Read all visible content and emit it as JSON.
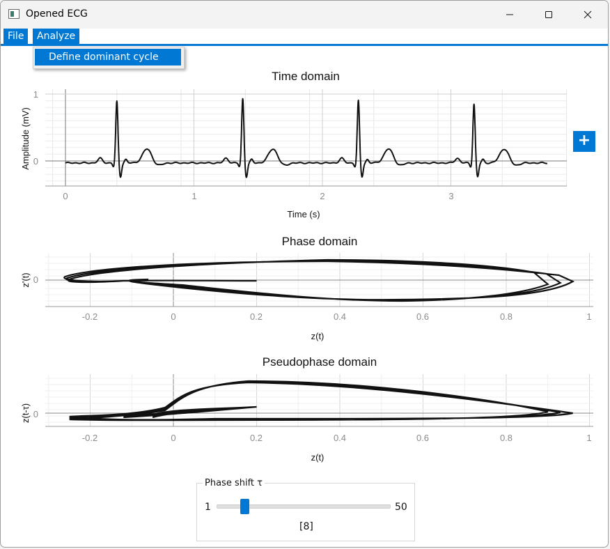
{
  "window": {
    "title": "Opened ECG"
  },
  "menu": {
    "file": "File",
    "analyze": "Analyze"
  },
  "dropdown": {
    "items": [
      "Define dominant cycle"
    ]
  },
  "add_button": {
    "label": "+"
  },
  "plots": {
    "time": {
      "title": "Time domain",
      "xlabel": "Time (s)",
      "ylabel": "Amplitude (mV)",
      "xticks": [
        "0",
        "1",
        "2",
        "3"
      ],
      "yticks": [
        "1",
        "0"
      ]
    },
    "phase": {
      "title": "Phase domain",
      "xlabel": "z(t)",
      "ylabel": "z'(t)",
      "xticks": [
        "-0.2",
        "0",
        "0.2",
        "0.4",
        "0.6",
        "0.8",
        "1"
      ],
      "yticks": [
        "0"
      ]
    },
    "pseudo": {
      "title": "Pseudophase domain",
      "xlabel": "z(t)",
      "ylabel": "z(t-τ)",
      "xticks": [
        "-0.2",
        "0",
        "0.2",
        "0.4",
        "0.6",
        "0.8",
        "1"
      ],
      "yticks": [
        "0"
      ]
    }
  },
  "phase_shift": {
    "label": "Phase shift τ",
    "min": "1",
    "max": "50",
    "value_text": "[8]",
    "value": 8
  },
  "chart_data": [
    {
      "type": "line",
      "name": "time",
      "title": "Time domain",
      "xlabel": "Time (s)",
      "ylabel": "Amplitude (mV)",
      "xlim": [
        -0.1,
        3.9
      ],
      "ylim": [
        -0.38,
        1.1
      ],
      "beats_s": [
        0.4,
        1.38,
        2.28,
        3.18
      ],
      "r_peak_mV": [
        0.92,
        0.96,
        0.93,
        0.88
      ],
      "s_trough_mV": -0.24,
      "t_wave_mV": 0.19,
      "p_wave_mV": 0.07,
      "baseline_mV": -0.03,
      "duration_s": 3.75
    },
    {
      "type": "line",
      "name": "phase",
      "title": "Phase domain",
      "xlabel": "z(t)",
      "ylabel": "z'(t)",
      "xlim": [
        -0.3,
        1.01
      ],
      "loop": {
        "left_tip_z": -0.25,
        "right_tip_z": [
          0.9,
          0.93,
          0.96
        ],
        "upper_peak_z": 0.37,
        "lower_peak_z": 0.55,
        "inner_end_z": 0.2
      }
    },
    {
      "type": "line",
      "name": "pseudophase",
      "title": "Pseudophase domain",
      "xlabel": "z(t)",
      "ylabel": "z(t-τ)",
      "xlim": [
        -0.3,
        1.01
      ],
      "loop": {
        "left_tip_z": -0.25,
        "right_tip_z": [
          0.9,
          0.93,
          0.96
        ],
        "upper_peak_z": 0.18,
        "inner_end_z": 0.2
      }
    }
  ]
}
